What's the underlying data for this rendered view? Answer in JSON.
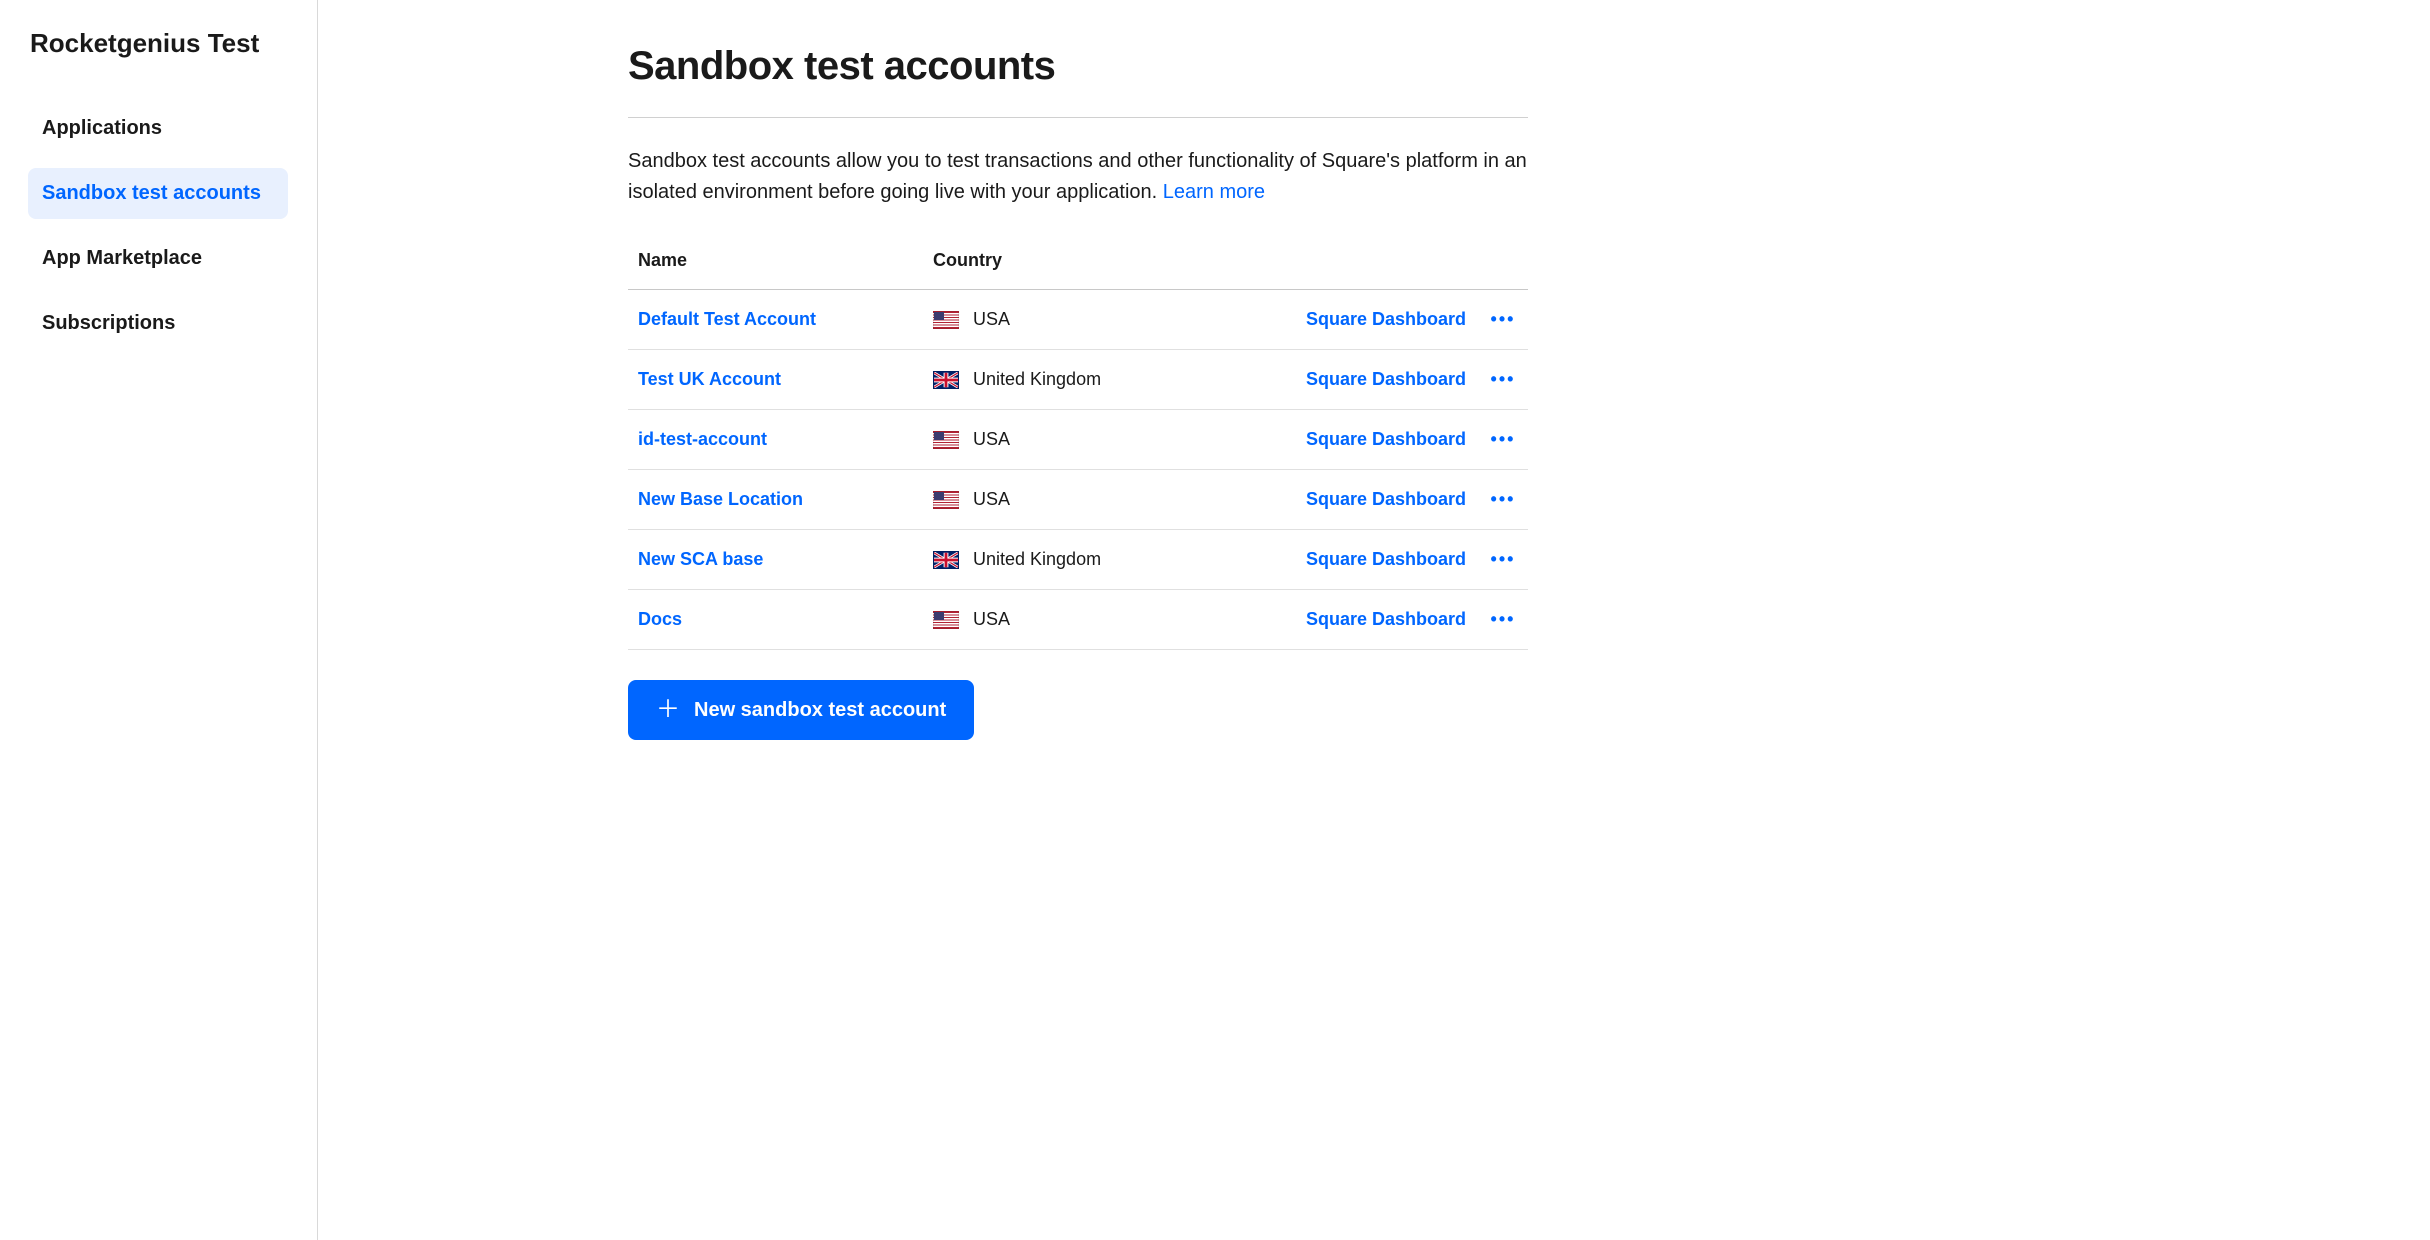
{
  "sidebar": {
    "title": "Rocketgenius Test",
    "items": [
      {
        "label": "Applications",
        "active": false
      },
      {
        "label": "Sandbox test accounts",
        "active": true
      },
      {
        "label": "App Marketplace",
        "active": false
      },
      {
        "label": "Subscriptions",
        "active": false
      }
    ]
  },
  "page": {
    "title": "Sandbox test accounts",
    "description": "Sandbox test accounts allow you to test transactions and other functionality of Square's platform in an isolated environment before going live with your application. ",
    "learn_more": "Learn more"
  },
  "table": {
    "headers": {
      "name": "Name",
      "country": "Country"
    },
    "action_label": "Square Dashboard",
    "rows": [
      {
        "name": "Default Test Account",
        "country": "USA",
        "flag": "us"
      },
      {
        "name": "Test UK Account",
        "country": "United Kingdom",
        "flag": "gb"
      },
      {
        "name": "id-test-account",
        "country": "USA",
        "flag": "us"
      },
      {
        "name": "New Base Location",
        "country": "USA",
        "flag": "us"
      },
      {
        "name": "New SCA base",
        "country": "United Kingdom",
        "flag": "gb"
      },
      {
        "name": "Docs",
        "country": "USA",
        "flag": "us"
      }
    ]
  },
  "new_button": {
    "label": "New sandbox test account"
  }
}
